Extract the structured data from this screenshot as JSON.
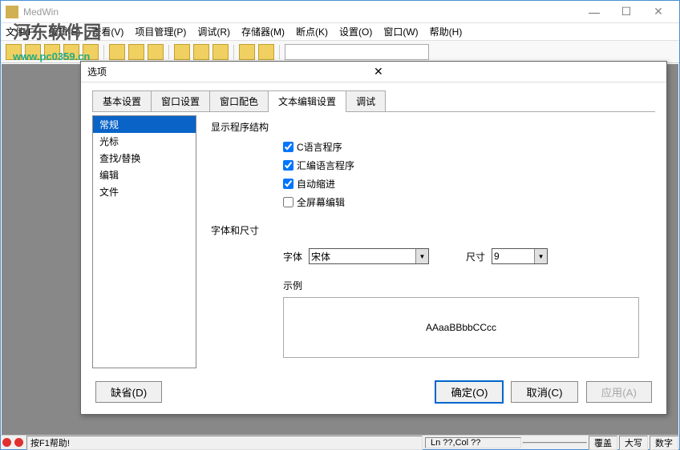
{
  "window": {
    "title": "MedWin",
    "min": "—",
    "max": "☐",
    "close": "✕"
  },
  "watermark": {
    "text": "河东软件园",
    "url": "www.pc0359.cn"
  },
  "menu": {
    "file": "文件(F)",
    "edit": "编辑(E)",
    "view": "查看(V)",
    "project": "项目管理(P)",
    "debug": "调试(R)",
    "memory": "存储器(M)",
    "breakpoint": "断点(K)",
    "settings": "设置(O)",
    "window": "窗口(W)",
    "help": "帮助(H)"
  },
  "dialog": {
    "title": "选项",
    "close": "✕",
    "tabs": [
      "基本设置",
      "窗口设置",
      "窗口配色",
      "文本编辑设置",
      "调试"
    ],
    "active_tab": 3,
    "sidebar": {
      "items": [
        "常规",
        "光标",
        "查找/替换",
        "编辑",
        "文件"
      ],
      "selected": 0
    },
    "struct_label": "显示程序结构",
    "checks": {
      "c_lang": {
        "label": "C语言程序",
        "checked": true
      },
      "asm": {
        "label": "汇编语言程序",
        "checked": true
      },
      "indent": {
        "label": "自动缩进",
        "checked": true
      },
      "fullscreen": {
        "label": "全屏幕编辑",
        "checked": false
      }
    },
    "font_size_label": "字体和尺寸",
    "font_label": "字体",
    "font_value": "宋体",
    "size_label": "尺寸",
    "size_value": "9",
    "sample_label": "示例",
    "sample_text": "AAaaBBbbCCcc",
    "defaults_btn": "缺省(D)",
    "ok_btn": "确定(O)",
    "cancel_btn": "取消(C)",
    "apply_btn": "应用(A)"
  },
  "status": {
    "hint": "按F1帮助!",
    "pos": "Ln ??,Col ??",
    "ovr": "覆盖",
    "caps": "大写",
    "num": "数字"
  }
}
